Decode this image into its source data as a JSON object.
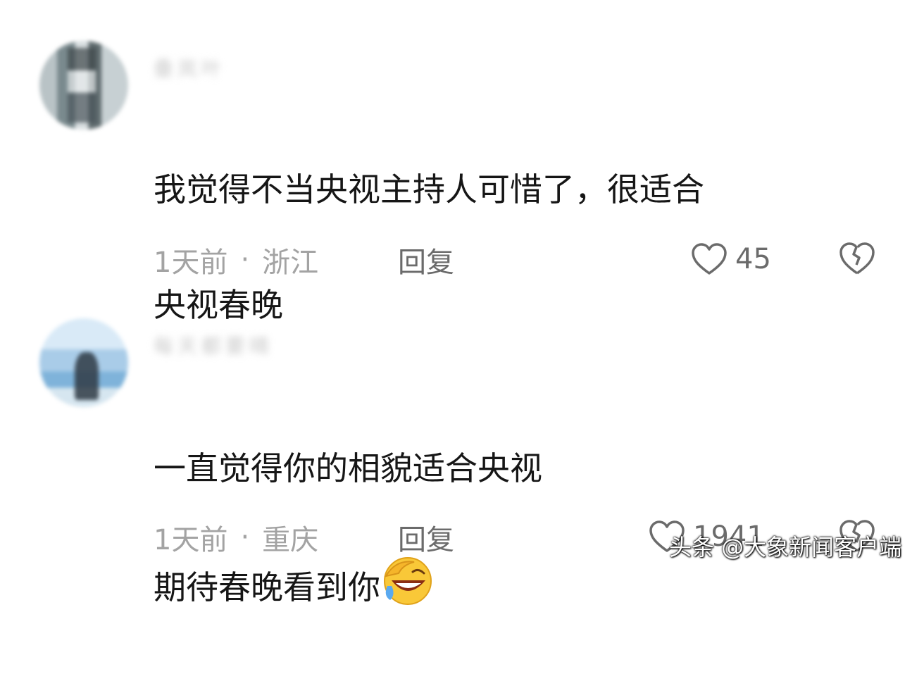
{
  "comments": [
    {
      "username": "叠岚叶",
      "text_lines": [
        "我觉得不当央视主持人可惜了，很适合",
        "央视春晚"
      ],
      "time": "1天前",
      "separator": "·",
      "location": "浙江",
      "reply_label": "回复",
      "like_count": "45",
      "like_icon": "heart-outline-icon",
      "dislike_icon": "broken-heart-icon"
    },
    {
      "username": "每天都要晴",
      "text_lines": [
        "一直觉得你的相貌适合央视",
        "期待春晚看到你"
      ],
      "emoji": "laughing-crying-emoji",
      "time": "1天前",
      "separator": "·",
      "location": "重庆",
      "reply_label": "回复",
      "like_count": "1941",
      "like_icon": "heart-outline-icon",
      "dislike_icon": "broken-heart-icon"
    }
  ],
  "watermark": "头条 @大象新闻客户端",
  "colors": {
    "text": "#161616",
    "meta": "#a3a3a3",
    "icon": "#6b6b6b",
    "background": "#ffffff"
  }
}
